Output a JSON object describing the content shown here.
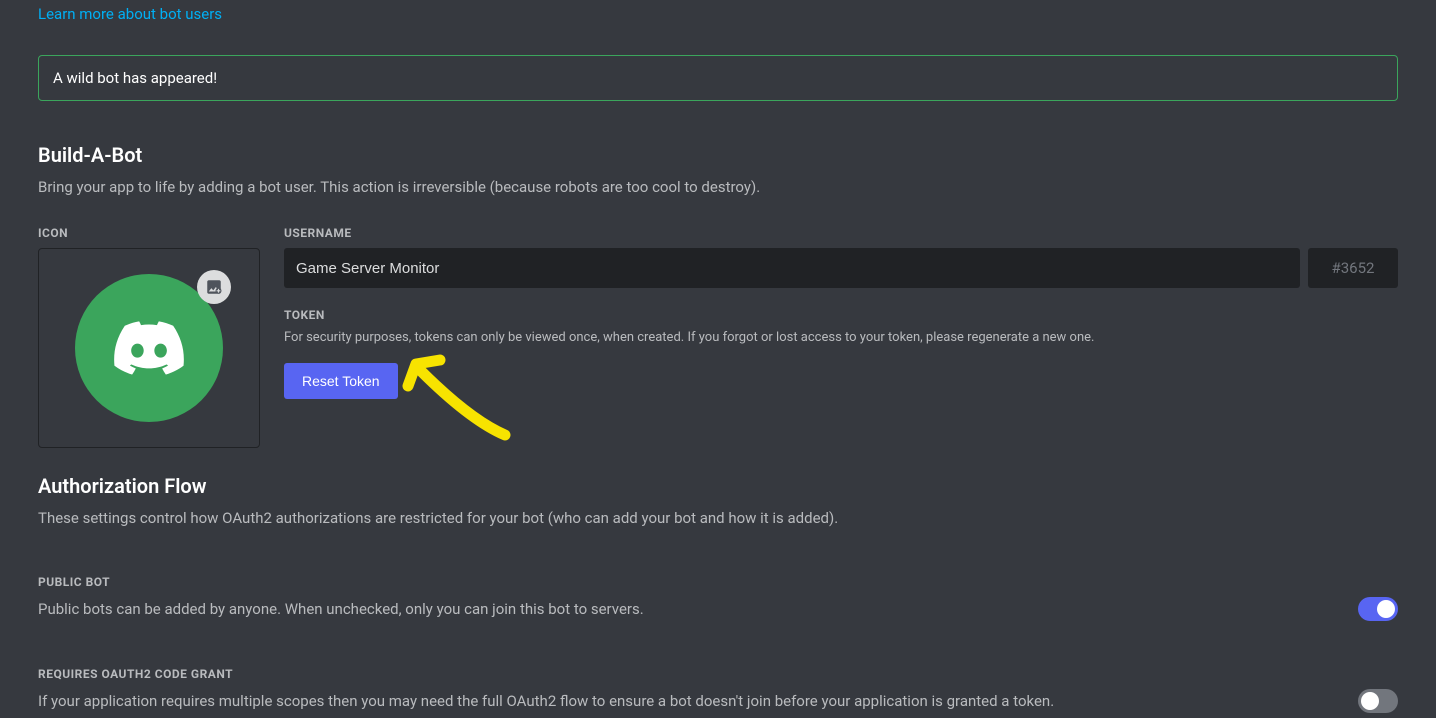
{
  "top_link": "Learn more about bot users",
  "alert": "A wild bot has appeared!",
  "build_section": {
    "title": "Build-A-Bot",
    "description": "Bring your app to life by adding a bot user. This action is irreversible (because robots are too cool to destroy)."
  },
  "icon_label": "ICON",
  "username": {
    "label": "USERNAME",
    "value": "Game Server Monitor",
    "discriminator": "#3652"
  },
  "token": {
    "label": "TOKEN",
    "note": "For security purposes, tokens can only be viewed once, when created. If you forgot or lost access to your token, please regenerate a new one.",
    "reset_label": "Reset Token"
  },
  "auth_flow": {
    "title": "Authorization Flow",
    "description": "These settings control how OAuth2 authorizations are restricted for your bot (who can add your bot and how it is added)."
  },
  "public_bot": {
    "label": "PUBLIC BOT",
    "description": "Public bots can be added by anyone. When unchecked, only you can join this bot to servers.",
    "enabled": true
  },
  "oauth2_grant": {
    "label": "REQUIRES OAUTH2 CODE GRANT",
    "description": "If your application requires multiple scopes then you may need the full OAuth2 flow to ensure a bot doesn't join before your application is granted a token.",
    "enabled": false
  }
}
